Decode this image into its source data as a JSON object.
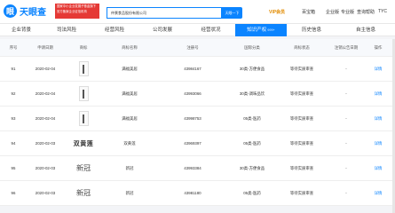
{
  "brand": {
    "name": "天眼查",
    "mark": "眼"
  },
  "promo": {
    "text": "国家中小企业发展子基金旗下官方备案企业征信机构"
  },
  "search": {
    "value": "仲景食品股份有限公司",
    "button": "天眼一下"
  },
  "header_nav": {
    "vip": "VIP会员",
    "business": "百宝箱",
    "enterprise": "企业版",
    "service": "专业版",
    "app": "查询帮助",
    "user": "TYC"
  },
  "tabs": [
    {
      "label": "企业背景",
      "count": ""
    },
    {
      "label": "司法风险",
      "count": ""
    },
    {
      "label": "经营风险",
      "count": ""
    },
    {
      "label": "公司发展",
      "count": ""
    },
    {
      "label": "经营状况",
      "count": ""
    },
    {
      "label": "知识产权",
      "count": "999+"
    },
    {
      "label": "历史信息",
      "count": ""
    },
    {
      "label": "自主信息",
      "count": ""
    }
  ],
  "columns": [
    "序号",
    "申请日期",
    "商标",
    "商标名称",
    "注册号",
    "国际分类",
    "商标状态",
    "注销公告日期",
    "操作"
  ],
  "rows": [
    {
      "index": "91",
      "date": "2020-02-04",
      "mark_type": "img",
      "mark_text": "",
      "name": "满福美居",
      "reg": "43984167",
      "class": "30类-方便食品",
      "status": "等待实质审查",
      "cancel": "-",
      "action": "详情"
    },
    {
      "index": "92",
      "date": "2020-02-04",
      "mark_type": "img",
      "mark_text": "",
      "name": "满福美居",
      "reg": "43993066",
      "class": "30类-调味品饮",
      "status": "等待实质审查",
      "cancel": "-",
      "action": "详情"
    },
    {
      "index": "93",
      "date": "2020-02-04",
      "mark_type": "img",
      "mark_text": "",
      "name": "满福美居",
      "reg": "43998753",
      "class": "05类-医药",
      "status": "等待实质审查",
      "cancel": "-",
      "action": "详情"
    },
    {
      "index": "94",
      "date": "2020-02-03",
      "mark_type": "calli",
      "mark_text": "双黄莲",
      "name": "双黄莲",
      "reg": "43969397",
      "class": "05类-医药",
      "status": "等待实质审查",
      "cancel": "-",
      "action": "详情"
    },
    {
      "index": "95",
      "date": "2020-02-03",
      "mark_type": "text",
      "mark_text": "新冠",
      "name": "新冠",
      "reg": "43993384",
      "class": "30类-方便食品",
      "status": "等待实质审查",
      "cancel": "-",
      "action": "详情"
    },
    {
      "index": "96",
      "date": "2020-02-03",
      "mark_type": "text",
      "mark_text": "新冠",
      "name": "新冠",
      "reg": "43981180",
      "class": "05类-医药",
      "status": "等待实质审查",
      "cancel": "-",
      "action": "详情"
    }
  ]
}
